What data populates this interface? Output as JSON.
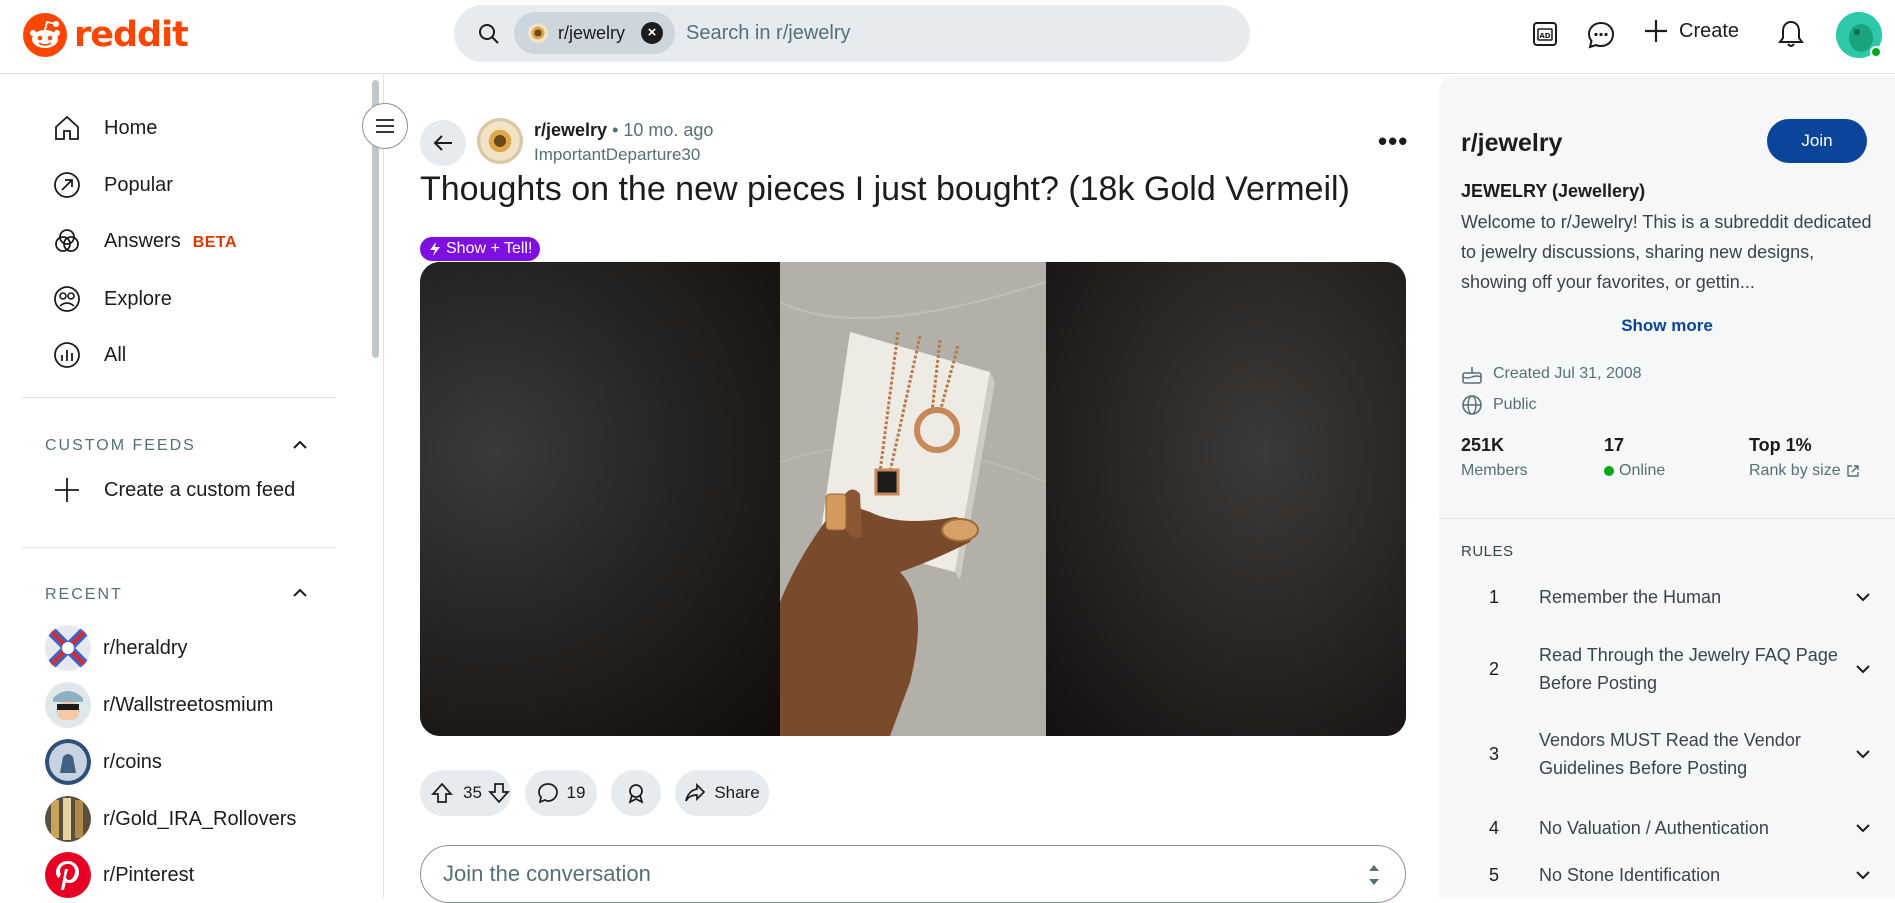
{
  "header": {
    "logo_text": "reddit",
    "search_chip": "r/jewelry",
    "search_placeholder": "Search in r/jewelry",
    "create_label": "Create"
  },
  "sidebar": {
    "nav": [
      {
        "label": "Home",
        "icon": "home-icon"
      },
      {
        "label": "Popular",
        "icon": "popular-icon"
      },
      {
        "label": "Answers",
        "icon": "answers-icon",
        "badge": "BETA"
      },
      {
        "label": "Explore",
        "icon": "explore-icon"
      },
      {
        "label": "All",
        "icon": "all-icon"
      }
    ],
    "custom_feeds_title": "CUSTOM FEEDS",
    "create_custom_feed": "Create a custom feed",
    "recent_title": "RECENT",
    "recent": [
      {
        "label": "r/heraldry"
      },
      {
        "label": "r/Wallstreetosmium"
      },
      {
        "label": "r/coins"
      },
      {
        "label": "r/Gold_IRA_Rollovers"
      },
      {
        "label": "r/Pinterest"
      }
    ]
  },
  "post": {
    "subreddit": "r/jewelry",
    "time": "• 10 mo. ago",
    "author": "ImportantDeparture30",
    "title": "Thoughts on the new pieces I just bought? (18k Gold Vermeil)",
    "flair": "Show + Tell!",
    "flair_color": "#7e0fe0",
    "votes": "35",
    "comments": "19",
    "share_label": "Share",
    "comment_placeholder": "Join the conversation"
  },
  "community": {
    "name": "r/jewelry",
    "join_label": "Join",
    "tagline": "JEWELRY (Jewellery)",
    "description": "Welcome to r/Jewelry! This is a subreddit dedicated to jewelry discussions, sharing new designs, showing off your favorites, or gettin...",
    "show_more": "Show more",
    "created": "Created Jul 31, 2008",
    "visibility": "Public",
    "stats": [
      {
        "value": "251K",
        "label": "Members"
      },
      {
        "value": "17",
        "label": "Online"
      },
      {
        "value": "Top 1%",
        "label": "Rank by size"
      }
    ],
    "rules_title": "RULES",
    "rules": [
      {
        "n": "1",
        "text": "Remember the Human"
      },
      {
        "n": "2",
        "text": "Read Through the Jewelry FAQ Page Before Posting"
      },
      {
        "n": "3",
        "text": "Vendors MUST Read the Vendor Guidelines Before Posting"
      },
      {
        "n": "4",
        "text": "No Valuation / Authentication"
      },
      {
        "n": "5",
        "text": "No Stone Identification"
      }
    ],
    "join_color": "#0a449b"
  },
  "colors": {
    "brand": "#ff4500",
    "online": "#01a816"
  }
}
